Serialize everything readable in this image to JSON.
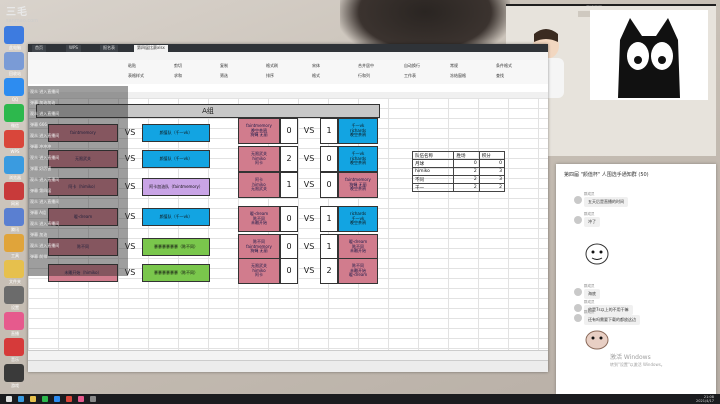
{
  "site_logo": {
    "main": "三毛",
    "sub": "sanmao.com"
  },
  "desktop_icons": [
    {
      "label": "此电脑",
      "color": "#3d7be0"
    },
    {
      "label": "回收站",
      "color": "#7a9bd6"
    },
    {
      "label": "QQ",
      "color": "#2d8cf0"
    },
    {
      "label": "微信",
      "color": "#2db84d"
    },
    {
      "label": "WPS",
      "color": "#d9463a"
    },
    {
      "label": "浏览器",
      "color": "#3a9be0"
    },
    {
      "label": "网易",
      "color": "#c83a3a"
    },
    {
      "label": "腾讯",
      "color": "#5a7fd1"
    },
    {
      "label": "工具",
      "color": "#e0a43a"
    },
    {
      "label": "文件夹",
      "color": "#e6c04d"
    },
    {
      "label": "设置",
      "color": "#6b6b6b"
    },
    {
      "label": "直播",
      "color": "#e65a8d"
    },
    {
      "label": "音乐",
      "color": "#d63a3a"
    },
    {
      "label": "游戏",
      "color": "#3a3a3a"
    }
  ],
  "excel": {
    "window_tabs": [
      "首页",
      "WPS",
      "报名表",
      "第四届比赛xlsx"
    ],
    "menu": [
      "文件",
      "开始",
      "插入",
      "页面布局",
      "公式",
      "数据",
      "审阅",
      "视图",
      "开发工具",
      "会员专享",
      "查找"
    ],
    "ribbon_buttons": [
      "粘贴",
      "剪切",
      "复制",
      "格式刷",
      "宋体",
      "合并居中",
      "自动换行",
      "常规",
      "条件格式",
      "表格样式",
      "求和",
      "筛选",
      "排序",
      "格式",
      "行和列",
      "工作表",
      "冻结窗格",
      "查找"
    ],
    "sheet_tabs": [
      "报名表",
      "A组",
      "B组",
      "C组",
      "积分表",
      "淘汰赛",
      "决赛",
      "观众投票",
      "比赛记录"
    ],
    "group_title": "A组",
    "bracket": [
      {
        "left": [
          "faintmemory",
          "晚空茶鸦",
          "狗蝇 无丽"
        ],
        "left_color": "pink",
        "score_a": "0",
        "vs": "VS",
        "score_b": "1",
        "right": [
          "千一vk",
          "richards",
          "晚空茶鸦"
        ],
        "right_color": "blue"
      },
      {
        "left": [
          "无限武关",
          "himiko",
          "阿卡"
        ],
        "left_color": "pink",
        "score_a": "2",
        "vs": "VS",
        "score_b": "0",
        "right": [
          "千一vk",
          "richards",
          "晚空茶鸦"
        ],
        "right_color": "blue"
      },
      {
        "left": [
          "阿卡",
          "himiko",
          "无限武关"
        ],
        "left_color": "pink",
        "score_a": "1",
        "vs": "VS",
        "score_b": "0",
        "right": [
          "faintmemory",
          "狗蝇 无丽",
          "晚空茶鸦"
        ],
        "right_color": "pink"
      },
      {
        "left": [
          "暖-dream",
          "陈不同",
          "未雕开始"
        ],
        "left_color": "pink",
        "score_a": "0",
        "vs": "VS",
        "score_b": "1",
        "right": [
          "richards",
          "千一vk",
          "晚空茶鸦"
        ],
        "right_color": "blue"
      },
      {
        "left": [
          "陈不同",
          "faintmemory",
          "狗蝇 无丽"
        ],
        "left_color": "pink",
        "score_a": "0",
        "vs": "VS",
        "score_b": "1",
        "right": [
          "暖-dream",
          "陈不同",
          "未雕开始"
        ],
        "right_color": "pink"
      },
      {
        "left": [
          "无限武关",
          "himiko",
          "阿卡"
        ],
        "left_color": "pink",
        "score_a": "0",
        "vs": "VS",
        "score_b": "2",
        "right": [
          "陈不同",
          "未雕开始",
          "暖-dream"
        ],
        "right_color": "pink"
      }
    ],
    "left_matches": [
      {
        "team": "faintmemory",
        "vs": "VS",
        "opponent": "颜值队（千一vk）",
        "team_color": "pink",
        "opp_color": "blue"
      },
      {
        "team": "无限武关",
        "vs": "VS",
        "opponent": "颜值队（千一vk）",
        "team_color": "pink",
        "opp_color": "blue"
      },
      {
        "team": "阿卡（himiko）",
        "vs": "VS",
        "opponent": "阿卡加油队（faintmemory）",
        "team_color": "pink",
        "opp_color": "purp"
      },
      {
        "team": "暖-dream",
        "vs": "VS",
        "opponent": "颜值队（千一vk）",
        "team_color": "pink",
        "opp_color": "blue"
      },
      {
        "team": "陈不同",
        "vs": "VS",
        "opponent": "暴暴暴暴暴暴（陈不同）",
        "team_color": "pink",
        "opp_color": "green"
      },
      {
        "team": "未雕开始（himiko）",
        "vs": "VS",
        "opponent": "暴暴暴暴暴暴（陈不同）",
        "team_color": "pink",
        "opp_color": "green"
      }
    ],
    "overlay_lines": [
      "观众 进入直播间",
      "弹幕 加油加油",
      "观众 进入直播间",
      "弹幕 666",
      "观众 进入直播间",
      "弹幕 冲冲冲",
      "观众 进入直播间",
      "弹幕 好厉害",
      "观众 进入直播间",
      "弹幕 第四届",
      "观众 进入直播间",
      "弹幕 A组",
      "观众 进入直播间",
      "弹幕 加油",
      "观众 进入直播间",
      "弹幕 前排"
    ],
    "points_table": {
      "headers": [
        "队伍名称",
        "胜场",
        "积分"
      ],
      "rows": [
        [
          "月球",
          "0",
          "0"
        ],
        [
          "himiko",
          "2",
          "3"
        ],
        [
          "不同",
          "2",
          "3"
        ],
        [
          "千一",
          "2",
          "2"
        ]
      ]
    }
  },
  "chat": {
    "title": "第四届 \"颜值杯\" 人围选手通知群 (50)",
    "messages": [
      {
        "user": "群成员",
        "text": "五天后是直播的时间"
      },
      {
        "user": "群成员",
        "text": "冲了"
      },
      {
        "user": "群成员",
        "text": "海底"
      },
      {
        "user": "群成员",
        "text": "他是7s以上的不用干嘛"
      },
      {
        "user": "群成员",
        "text": "还有吗需要下载的都放这边"
      }
    ],
    "activate_windows": [
      "激活 Windows",
      "转到\"设置\"以激活 Windows。"
    ]
  },
  "webcam": {
    "title": "直播画面"
  },
  "taskbar": {
    "time": "21:08",
    "date": "2021/4/17",
    "icon_colors": [
      "#e0e0e0",
      "#3a9be0",
      "#e6c04d",
      "#2db84d",
      "#2d8cf0",
      "#d9463a",
      "#e65a8d",
      "#888888"
    ]
  }
}
